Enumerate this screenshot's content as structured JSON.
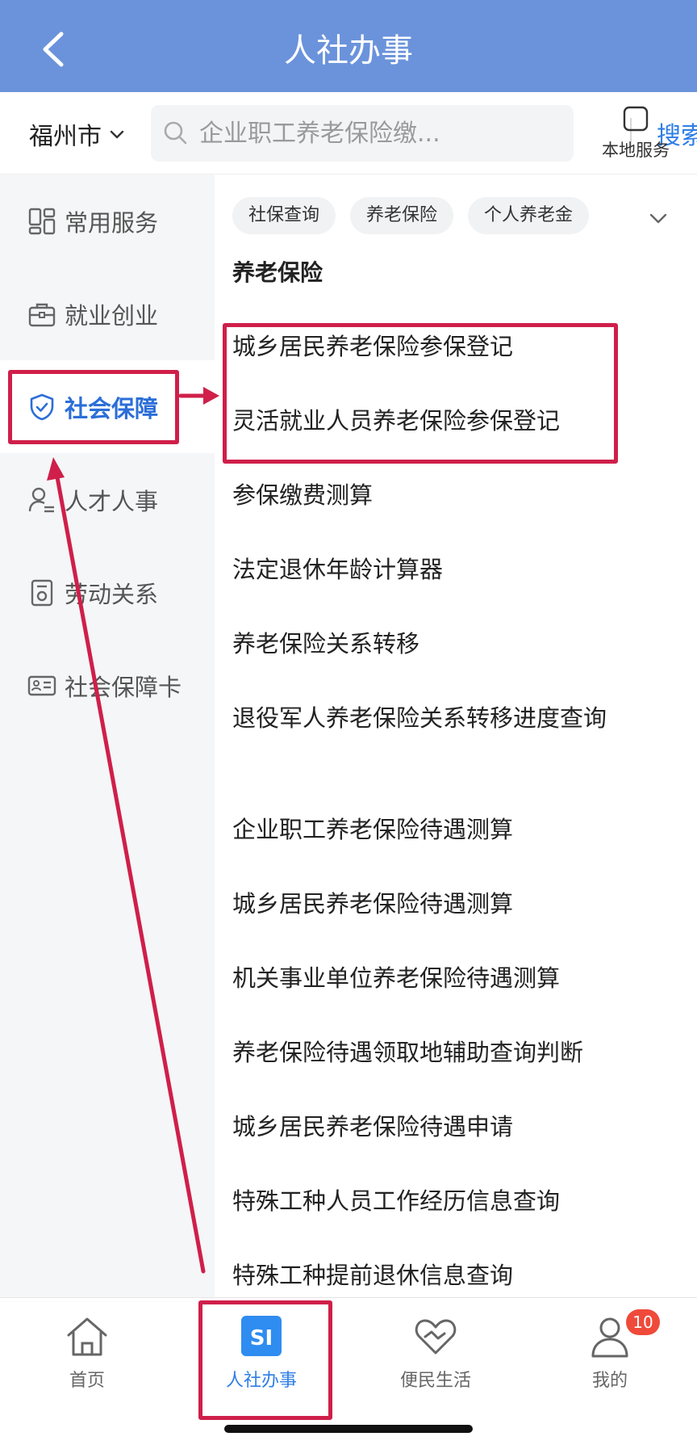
{
  "header": {
    "title": "人社办事",
    "back_icon": "chevron-left-icon"
  },
  "search_row": {
    "city": "福州市",
    "search_placeholder": "企业职工养老保险缴...",
    "search_button": "搜索",
    "local_service_label": "本地服务"
  },
  "sidebar": {
    "items": [
      {
        "label": "常用服务",
        "icon": "grid-icon"
      },
      {
        "label": "就业创业",
        "icon": "briefcase-icon"
      },
      {
        "label": "社会保障",
        "icon": "shield-icon",
        "active": true
      },
      {
        "label": "人才人事",
        "icon": "person-list-icon"
      },
      {
        "label": "劳动关系",
        "icon": "document-icon"
      },
      {
        "label": "社会保障卡",
        "icon": "id-card-icon"
      }
    ]
  },
  "content": {
    "chips": [
      "社保查询",
      "养老保险",
      "个人养老金"
    ],
    "section_title": "养老保险",
    "items": [
      "城乡居民养老保险参保登记",
      "灵活就业人员养老保险参保登记",
      "参保缴费测算",
      "法定退休年龄计算器",
      "养老保险关系转移",
      "退役军人养老保险关系转移进度查询",
      "企业职工养老保险待遇测算",
      "城乡居民养老保险待遇测算",
      "机关事业单位养老保险待遇测算",
      "养老保险待遇领取地辅助查询判断",
      "城乡居民养老保险待遇申请",
      "特殊工种人员工作经历信息查询",
      "特殊工种提前退休信息查询"
    ]
  },
  "bottom_nav": {
    "items": [
      {
        "label": "首页",
        "icon": "home-icon"
      },
      {
        "label": "人社办事",
        "icon": "si-logo-icon",
        "logo_text": "SI",
        "active": true
      },
      {
        "label": "便民生活",
        "icon": "heart-hand-icon"
      },
      {
        "label": "我的",
        "icon": "user-icon",
        "badge": "10"
      }
    ]
  },
  "colors": {
    "header": "#6b93db",
    "accent": "#2f7ee6",
    "annotation": "#cf1f4a",
    "badge": "#ef4a3a"
  }
}
